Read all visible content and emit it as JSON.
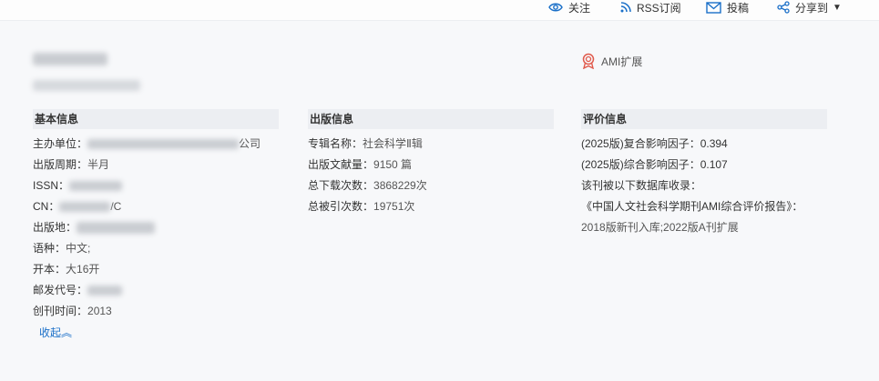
{
  "topbar": {
    "follow": "关注",
    "rss": "RSS订阅",
    "submit": "投稿",
    "share": "分享到"
  },
  "ami_badge": "AMI扩展",
  "basic": {
    "title": "基本信息",
    "sponsor_label": "主办单位：",
    "sponsor_suffix": "公司",
    "period_label": "出版周期：",
    "period_value": "半月",
    "issn_label": "ISSN：",
    "cn_label": "CN：",
    "cn_suffix": "/C",
    "place_label": "出版地：",
    "lang_label": "语种：",
    "lang_value": "中文;",
    "format_label": "开本：",
    "format_value": "大16开",
    "post_label": "邮发代号：",
    "founded_label": "创刊时间：",
    "founded_value": "2013",
    "collapse": "收起︽"
  },
  "publish": {
    "title": "出版信息",
    "rows": [
      {
        "label": "专辑名称：",
        "value": "社会科学Ⅱ辑"
      },
      {
        "label": "出版文献量：",
        "value": "9150 篇"
      },
      {
        "label": "总下载次数：",
        "value": "3868229次"
      },
      {
        "label": "总被引次数：",
        "value": "19751次"
      }
    ]
  },
  "eval": {
    "title": "评价信息",
    "rows": [
      "(2025版)复合影响因子：0.394",
      "(2025版)综合影响因子：0.107",
      "该刊被以下数据库收录：",
      "《中国人文社会科学期刊AMI综合评价报告》：",
      "2018版新刊入库;2022版A刊扩展"
    ]
  },
  "colors": {
    "accent": "#1a6fc8",
    "header_bg": "#eceef2",
    "page_bg": "#f7f8fa"
  }
}
